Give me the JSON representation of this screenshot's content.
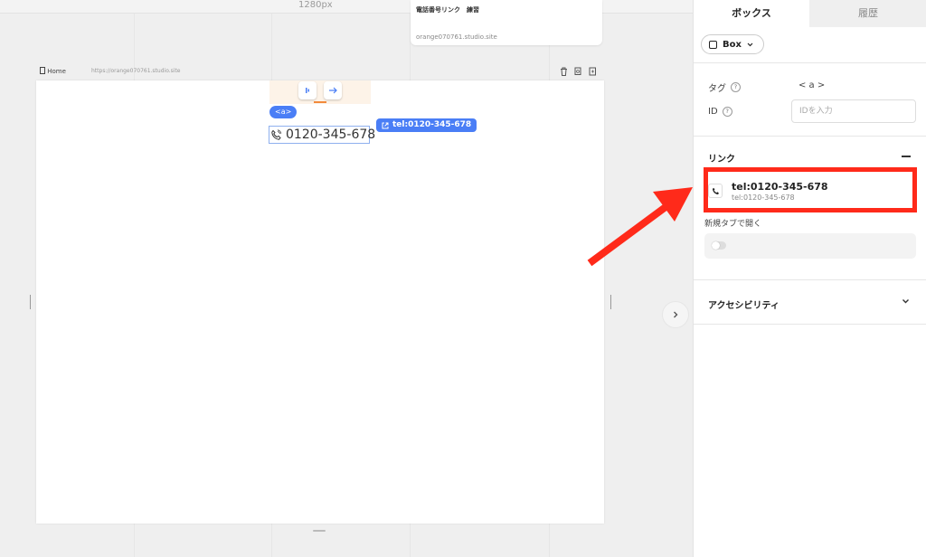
{
  "canvas": {
    "ruler_label": "1280px",
    "site_card": {
      "title": "電話番号リンク　練習",
      "url": "orange070761.studio.site"
    },
    "frame": {
      "page_name": "Home",
      "url": "https://orange070761.studio.site"
    },
    "selection": {
      "tag_badge": "<a>",
      "phone_number": "0120-345-678",
      "link_badge": "tel:0120-345-678"
    }
  },
  "panel": {
    "tabs": [
      {
        "label": "ボックス",
        "active": true
      },
      {
        "label": "履歴",
        "active": false
      }
    ],
    "element_type": "Box",
    "tag": {
      "label": "タグ",
      "value": "< a >"
    },
    "id_field": {
      "label": "ID",
      "value": "",
      "placeholder": "IDを入力"
    },
    "link_section": {
      "title": "リンク",
      "card_title": "tel:0120-345-678",
      "card_subtitle": "tel:0120-345-678",
      "new_tab_label": "新規タブで開く",
      "new_tab_enabled": false
    },
    "accessibility": {
      "title": "アクセシビリティ"
    }
  },
  "colors": {
    "accent_blue": "#4a7ef6",
    "annotation_red": "#ff2a1a",
    "highlight_orange": "#f28a3b"
  },
  "icons": [
    "trash-icon",
    "copy-icon",
    "page-icon",
    "phone-icon",
    "chevron-right-icon",
    "chevron-down-icon",
    "external-link-icon",
    "help-icon"
  ]
}
